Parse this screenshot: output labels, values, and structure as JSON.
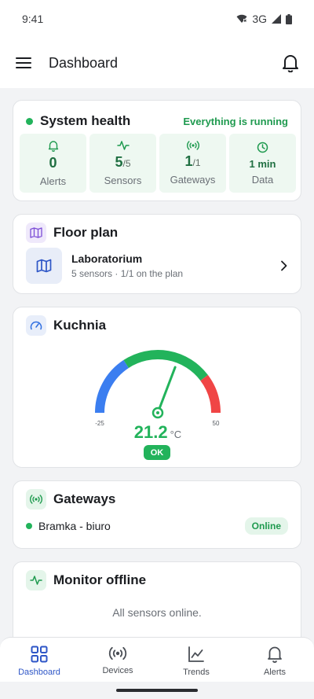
{
  "status_bar": {
    "time": "9:41",
    "network": "3G"
  },
  "app_bar": {
    "title": "Dashboard"
  },
  "system_health": {
    "title": "System health",
    "status": "Everything is running",
    "stats": [
      {
        "icon": "bell-icon",
        "value": "0",
        "total": "",
        "label": "Alerts"
      },
      {
        "icon": "activity-icon",
        "value": "5",
        "total": "/5",
        "label": "Sensors"
      },
      {
        "icon": "broadcast-icon",
        "value": "1",
        "total": "/1",
        "label": "Gateways"
      },
      {
        "icon": "clock-icon",
        "value": "1 min",
        "total": "",
        "label": "Data"
      }
    ]
  },
  "floor_plan": {
    "title": "Floor plan",
    "item": {
      "name": "Laboratorium",
      "details": "5 sensors · 1/1 on the plan"
    }
  },
  "gauge": {
    "title": "Kuchnia",
    "min_label": "-25",
    "max_label": "50",
    "value": "21.2",
    "value_number": 21.2,
    "unit": "°C",
    "status": "OK",
    "min": -25,
    "max": 50,
    "colors": {
      "low": "#3b7ef0",
      "normal": "#22b35b",
      "high": "#f04545"
    }
  },
  "gateways": {
    "title": "Gateways",
    "items": [
      {
        "name": "Bramka - biuro",
        "status": "Online"
      }
    ]
  },
  "monitor": {
    "title": "Monitor offline",
    "message": "All sensors online."
  },
  "bottom_nav": {
    "items": [
      {
        "label": "Dashboard",
        "icon": "dashboard-grid-icon",
        "active": true
      },
      {
        "label": "Devices",
        "icon": "devices-icon",
        "active": false
      },
      {
        "label": "Trends",
        "icon": "trends-icon",
        "active": false
      },
      {
        "label": "Alerts",
        "icon": "bell-icon",
        "active": false
      }
    ]
  },
  "colors": {
    "accent": "#2e56c7",
    "success": "#22b35b",
    "success_dark": "#1f6f41"
  }
}
